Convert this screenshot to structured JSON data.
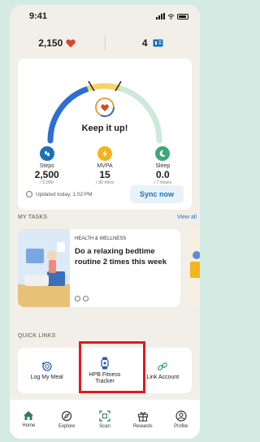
{
  "status_bar": {
    "time": "9:41"
  },
  "header": {
    "points": "2,150",
    "tickets": "4"
  },
  "summary": {
    "title": "Keep it up!"
  },
  "metrics": [
    {
      "label": "Steps",
      "value": "2,500",
      "target": "/ 5,000",
      "color": "#1d70b8"
    },
    {
      "label": "MVPA",
      "value": "15",
      "target": "/ 30 mins",
      "color": "#f2b51f"
    },
    {
      "label": "Sleep",
      "value": "0.0",
      "target": "/ 7 hours",
      "color": "#3fa776"
    }
  ],
  "updated": "Updated today, 1:02 PM",
  "sync_label": "Sync now",
  "tasks": {
    "title": "MY TASKS",
    "view_all": "View all",
    "card": {
      "category": "HEALTH & WELLNESS",
      "title": "Do a relaxing bedtime routine 2 times this week"
    }
  },
  "quick_links": {
    "title": "QUICK LINKS",
    "items": [
      {
        "label": "Log My Meal"
      },
      {
        "label": "HPB Fitness Tracker"
      },
      {
        "label": "Link Account"
      }
    ]
  },
  "nav": {
    "items": [
      {
        "label": "Home"
      },
      {
        "label": "Explore"
      },
      {
        "label": "Scan"
      },
      {
        "label": "Rewards"
      },
      {
        "label": "Profile"
      }
    ]
  },
  "colors": {
    "accent": "#1d70b8",
    "highlight": "#e8161f",
    "brand_green": "#2e7d5b"
  }
}
